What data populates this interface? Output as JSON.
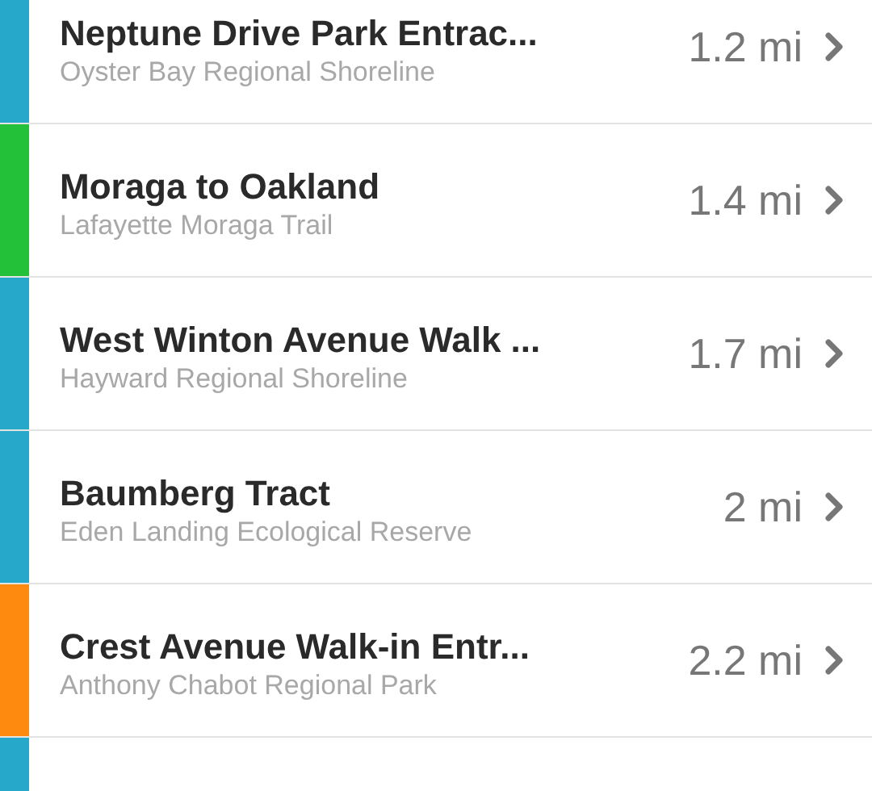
{
  "trails": [
    {
      "title": "Neptune Drive Park Entrac...",
      "subtitle": "Oyster Bay Regional Shoreline",
      "distance": "1.2 mi",
      "color": "#26a8cb"
    },
    {
      "title": "Moraga to Oakland",
      "subtitle": "Lafayette Moraga Trail",
      "distance": "1.4 mi",
      "color": "#23c13a"
    },
    {
      "title": "West Winton Avenue Walk ...",
      "subtitle": "Hayward Regional Shoreline",
      "distance": "1.7 mi",
      "color": "#26a8cb"
    },
    {
      "title": "Baumberg Tract",
      "subtitle": "Eden Landing Ecological Reserve",
      "distance": "2 mi",
      "color": "#26a8cb"
    },
    {
      "title": "Crest Avenue Walk-in Entr...",
      "subtitle": "Anthony Chabot Regional Park",
      "distance": "2.2 mi",
      "color": "#ff8a10"
    },
    {
      "color": "#26a8cb"
    }
  ]
}
